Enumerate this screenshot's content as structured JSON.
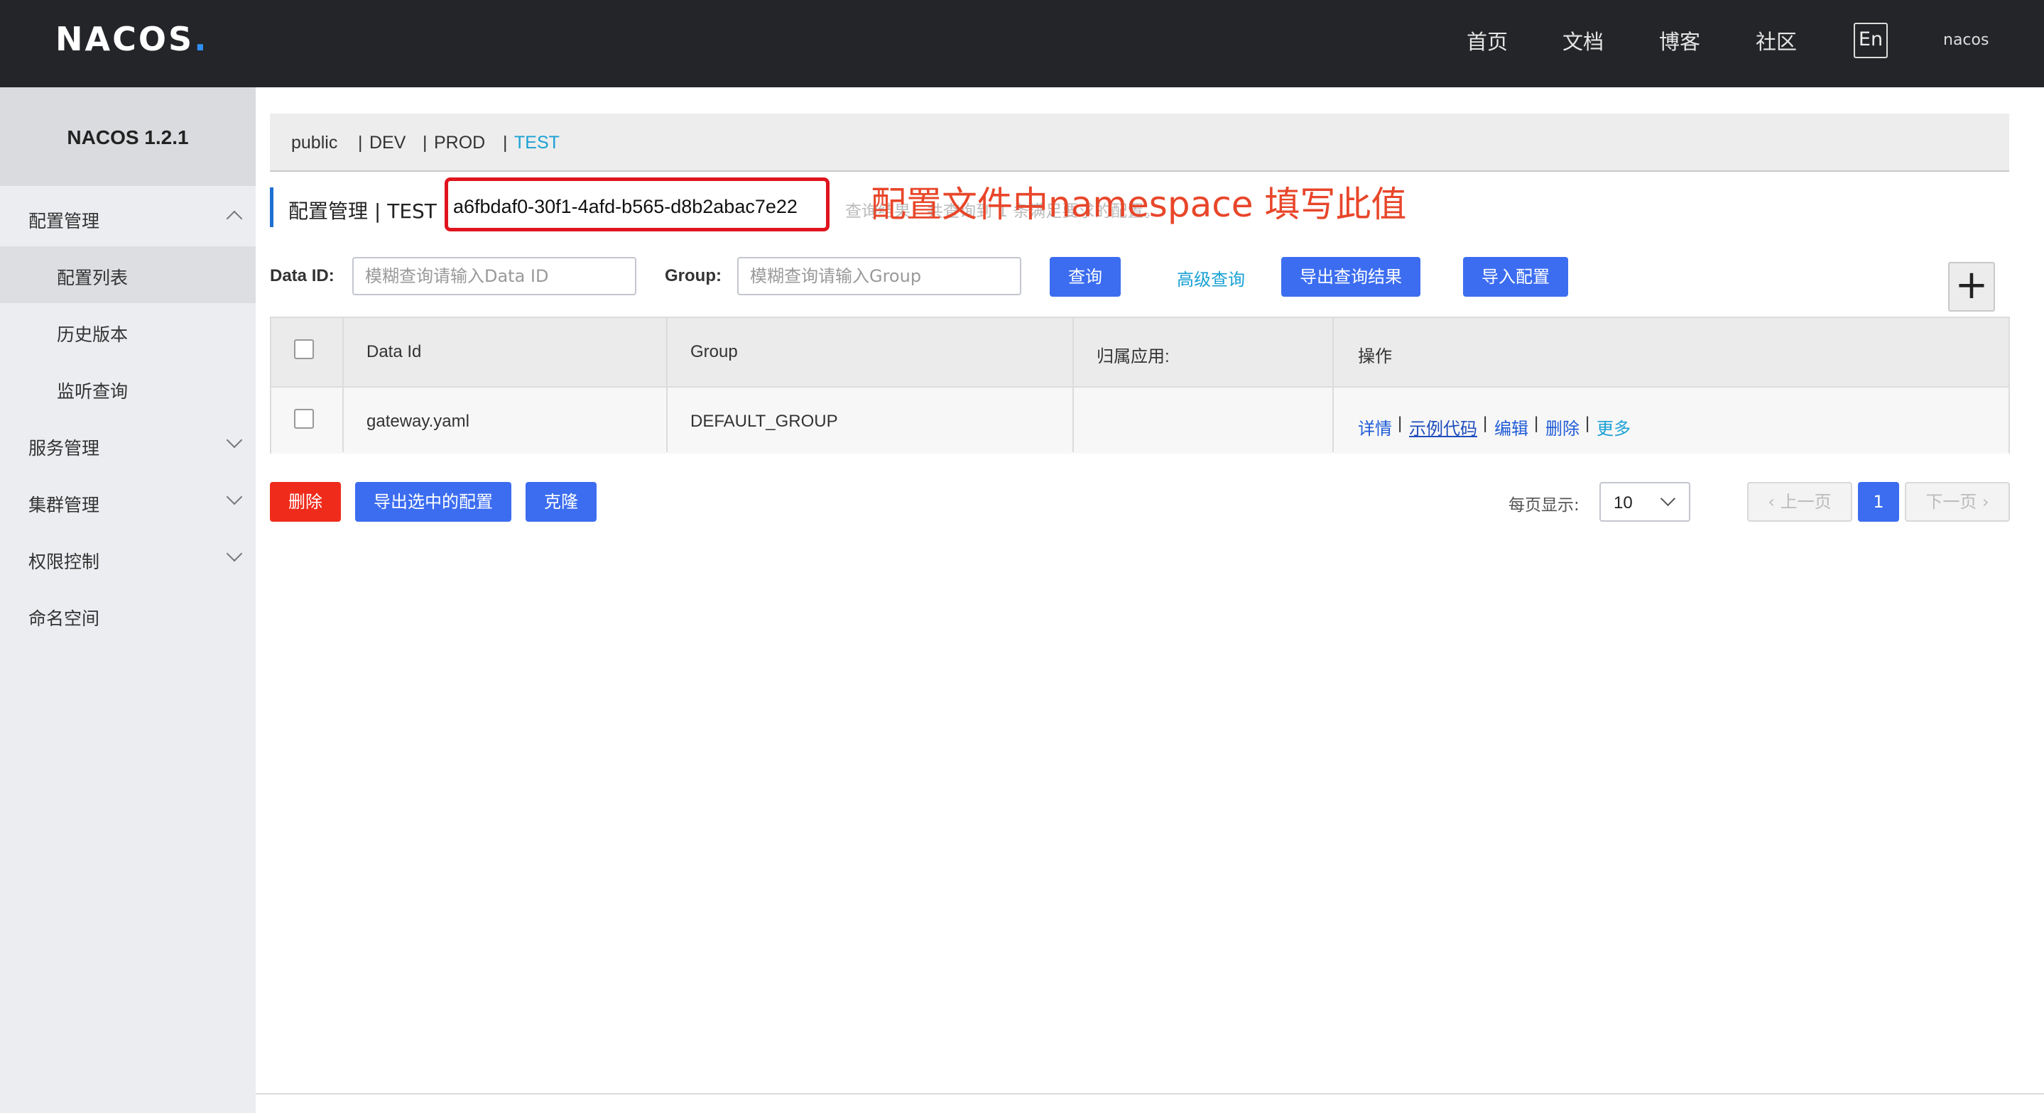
{
  "header": {
    "logo": "NACOS",
    "logo_dot": ".",
    "nav": [
      "首页",
      "文档",
      "博客",
      "社区"
    ],
    "lang": "En",
    "user": "nacos"
  },
  "sidebar": {
    "version": "NACOS 1.2.1",
    "items": [
      {
        "label": "配置管理",
        "chevron": "up"
      },
      {
        "label": "配置列表"
      },
      {
        "label": "历史版本"
      },
      {
        "label": "监听查询"
      },
      {
        "label": "服务管理",
        "chevron": "down"
      },
      {
        "label": "集群管理",
        "chevron": "down"
      },
      {
        "label": "权限控制",
        "chevron": "down"
      },
      {
        "label": "命名空间"
      }
    ]
  },
  "namespaces": {
    "items": [
      "public",
      "DEV",
      "PROD",
      "TEST"
    ],
    "separator": "|",
    "active": "TEST"
  },
  "page": {
    "title": "配置管理 | TEST",
    "namespace_id": "a6fbdaf0-30f1-4afd-b565-d8b2abac7e22",
    "query_result": "查询结果：共查询到 1 条满足要求的配置。",
    "annotation": "配置文件中namespace 填写此值"
  },
  "search": {
    "data_id_label": "Data ID:",
    "data_id_placeholder": "模糊查询请输入Data ID",
    "group_label": "Group:",
    "group_placeholder": "模糊查询请输入Group",
    "query_button": "查询",
    "advanced_link": "高级查询",
    "export_button": "导出查询结果",
    "import_button": "导入配置",
    "add_symbol": "+"
  },
  "table": {
    "columns": [
      "Data Id",
      "Group",
      "归属应用:",
      "操作"
    ],
    "rows": [
      {
        "data_id": "gateway.yaml",
        "group": "DEFAULT_GROUP",
        "app": "",
        "actions": [
          "详情",
          "示例代码",
          "编辑",
          "删除",
          "更多"
        ]
      }
    ]
  },
  "bulk_actions": {
    "delete": "删除",
    "export_selected": "导出选中的配置",
    "clone": "克隆"
  },
  "pagination": {
    "per_page_label": "每页显示:",
    "per_page": "10",
    "prev": "上一页",
    "next": "下一页",
    "current": "1"
  },
  "colors": {
    "topbar": "#242528",
    "primary": "#3c6df0",
    "danger": "#ef2b1b",
    "link": "#1aa1d4",
    "highlight_box": "#e0141e",
    "annotation": "#e8462a"
  }
}
